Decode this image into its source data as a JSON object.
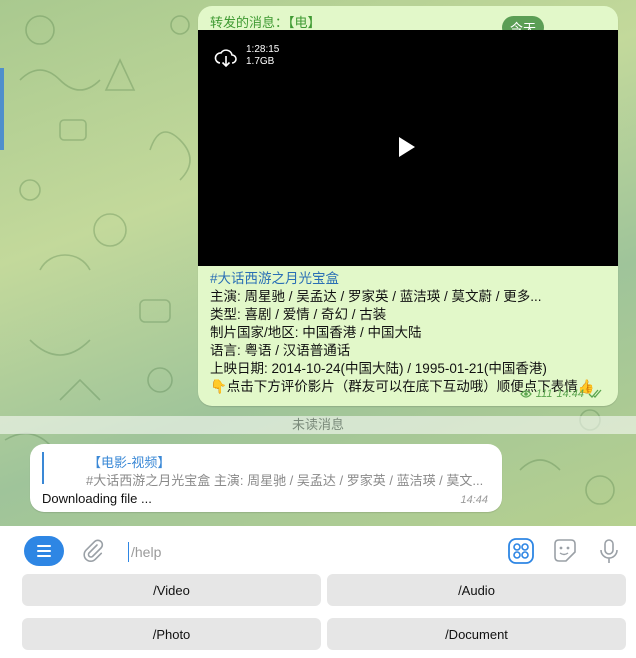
{
  "forwarded": {
    "header": "转发的消息：【电",
    "header_tail": "】",
    "date_pill": "今天",
    "video": {
      "duration": "1:28:15",
      "size": "1.7GB"
    },
    "caption": [
      "#大话西游之月光宝盒",
      "主演: 周星驰 / 吴孟达 / 罗家英 / 蓝洁瑛 / 莫文蔚 / 更多...",
      "类型: 喜剧 / 爱情 / 奇幻 / 古装",
      "制片国家/地区: 中国香港 / 中国大陆",
      "语言: 粤语 / 汉语普通话",
      "上映日期: 2014-10-24(中国大陆) / 1995-01-21(中国香港)",
      "👇点击下方评价影片（群友可以在底下互动哦）顺便点下表情👍"
    ],
    "views": "111",
    "time": "14:44"
  },
  "unread_label": "未读消息",
  "incoming": {
    "reply_title": "【电影-视频】",
    "reply_text": "#大话西游之月光宝盒 主演: 周星驰 / 吴孟达 / 罗家英 / 蓝洁瑛 / 莫文...",
    "text": "Downloading file ...",
    "time": "14:44"
  },
  "input": {
    "placeholder": "/help",
    "value": ""
  },
  "keyboard": {
    "buttons": [
      "/Video",
      "/Audio",
      "/Photo",
      "/Document"
    ]
  },
  "colors": {
    "accent": "#2e86e4",
    "out_bubble": "#e2f8c9",
    "chat_bg": "#b6d08f"
  }
}
